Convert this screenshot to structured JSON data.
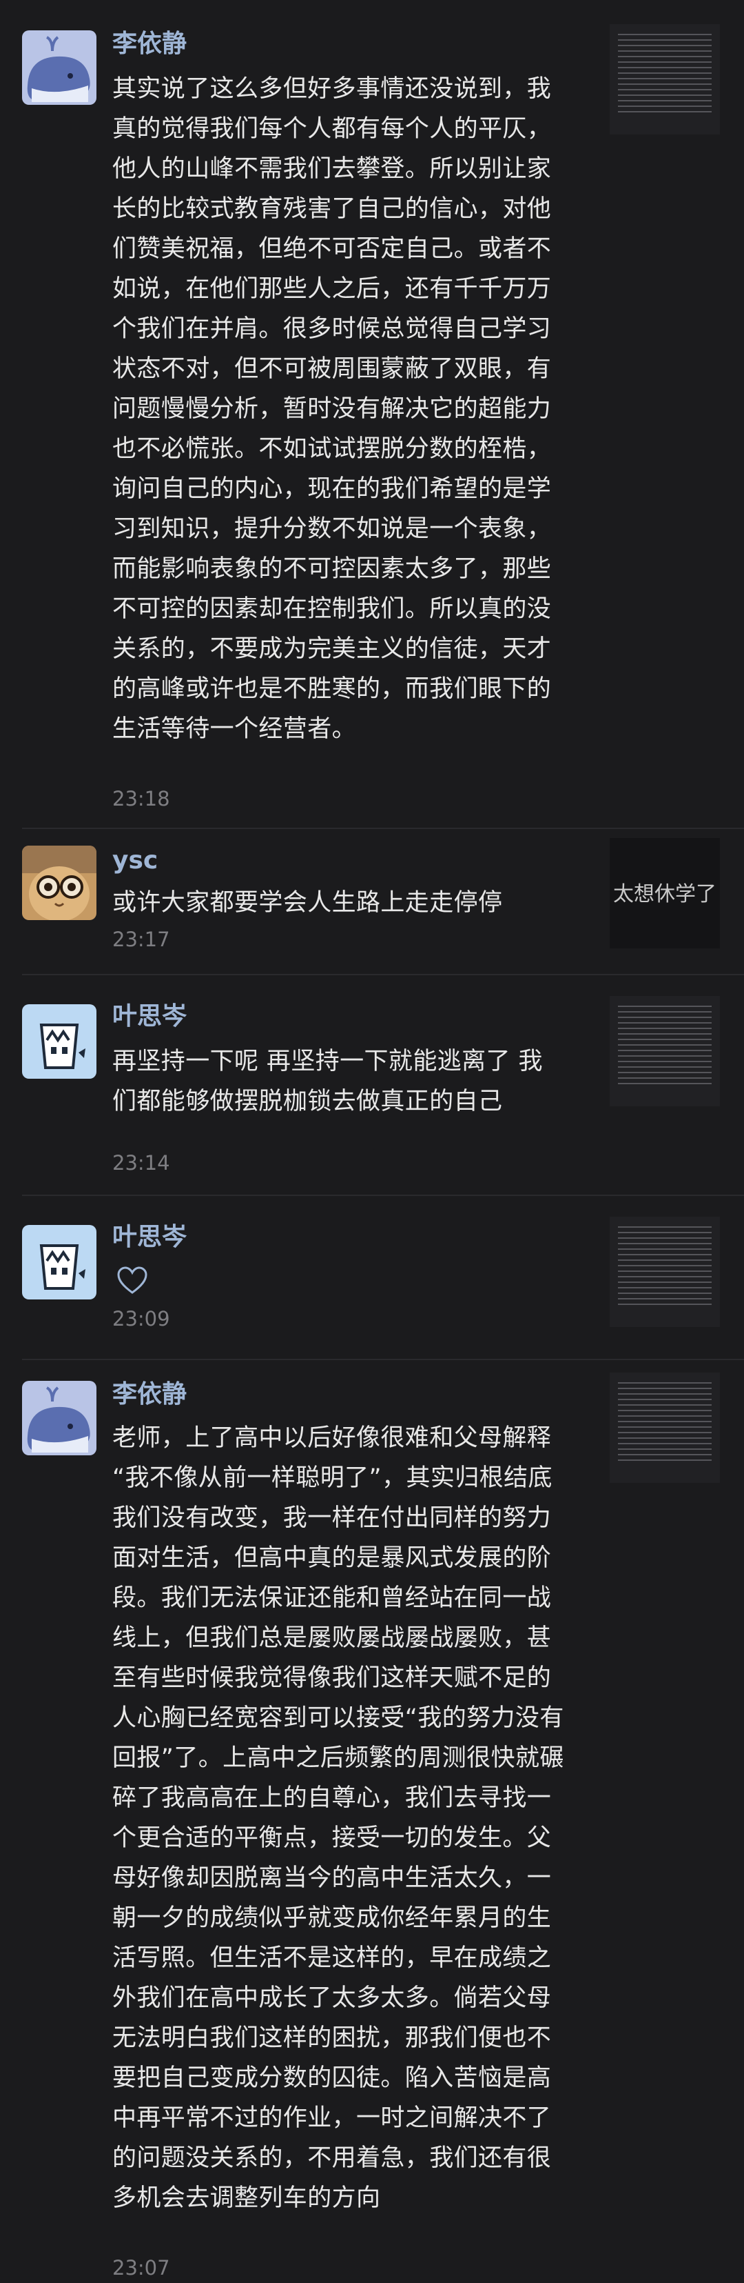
{
  "comments": [
    {
      "author": "李依静",
      "avatar": "whale-avatar",
      "text": "其实说了这么多但好多事情还没说到，我\n真的觉得我们每个人都有每个人的平仄，\n他人的山峰不需我们去攀登。所以别让家\n长的比较式教育残害了自己的信心，对他\n们赞美祝福，但绝不可否定自己。或者不\n如说，在他们那些人之后，还有千千万万\n个我们在并肩。很多时候总觉得自己学习\n状态不对，但不可被周围蒙蔽了双眼，有\n问题慢慢分析，暂时没有解决它的超能力\n也不必慌张。不如试试摆脱分数的桎梏，\n询问自己的内心，现在的我们希望的是学\n习到知识，提升分数不如说是一个表象，\n而能影响表象的不可控因素太多了，那些\n不可控的因素却在控制我们。所以真的没\n关系的，不要成为完美主义的信徒，天才\n的高峰或许也是不胜寒的，而我们眼下的\n生活等待一个经营者。",
      "time": "23:18",
      "thumb": "text-note"
    },
    {
      "author": "ysc",
      "avatar": "cat-glasses-avatar",
      "text": "或许大家都要学会人生路上走走停停",
      "time": "23:17",
      "thumb": "text-card",
      "thumb_text": "太想休学了"
    },
    {
      "author": "叶思岑",
      "avatar": "milk-cup-avatar",
      "text": "再坚持一下呢 再坚持一下就能逃离了 我\n们都能够做摆脱枷锁去做真正的自己",
      "time": "23:14",
      "thumb": "text-note"
    },
    {
      "author": "叶思岑",
      "avatar": "milk-cup-avatar",
      "reaction": "heart-icon",
      "time": "23:09",
      "thumb": "text-note"
    },
    {
      "author": "李依静",
      "avatar": "whale-avatar",
      "text": "老师，上了高中以后好像很难和父母解释\n“我不像从前一样聪明了”，其实归根结底\n我们没有改变，我一样在付出同样的努力\n面对生活，但高中真的是暴风式发展的阶\n段。我们无法保证还能和曾经站在同一战\n线上，但我们总是屡败屡战屡战屡败，甚\n至有些时候我觉得像我们这样天赋不足的\n人心胸已经宽容到可以接受“我的努力没有\n回报”了。上高中之后频繁的周测很快就碾\n碎了我高高在上的自尊心，我们去寻找一\n个更合适的平衡点，接受一切的发生。父\n母好像却因脱离当今的高中生活太久，一\n朝一夕的成绩似乎就变成你经年累月的生\n活写照。但生活不是这样的，早在成绩之\n外我们在高中成长了太多太多。倘若父母\n无法明白我们这样的困扰，那我们便也不\n要把自己变成分数的囚徒。陷入苦恼是高\n中再平常不过的作业，一时之间解决不了\n的问题没关系的，不用着急，我们还有很\n多机会去调整列车的方向",
      "time": "23:07",
      "thumb": "text-note"
    }
  ]
}
